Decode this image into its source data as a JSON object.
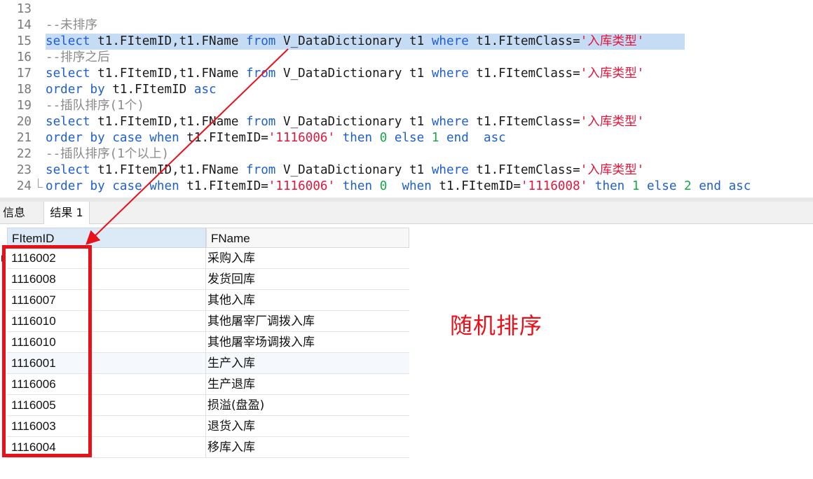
{
  "editor": {
    "lines": [
      {
        "n": "13",
        "tokens": []
      },
      {
        "n": "14",
        "tokens": [
          {
            "t": "--未排序",
            "c": "cm"
          }
        ]
      },
      {
        "n": "15",
        "highlight": true,
        "tokens": [
          {
            "t": "select",
            "c": "kw"
          },
          {
            "t": " t1.FItemID,t1.FName ",
            "c": "id"
          },
          {
            "t": "from",
            "c": "kw"
          },
          {
            "t": " V_DataDictionary t1 ",
            "c": "id"
          },
          {
            "t": "where",
            "c": "kw"
          },
          {
            "t": " t1.FItemClass=",
            "c": "id"
          },
          {
            "t": "'入库类型'",
            "c": "str"
          }
        ]
      },
      {
        "n": "16",
        "tokens": [
          {
            "t": "--排序之后",
            "c": "cm"
          }
        ]
      },
      {
        "n": "17",
        "tokens": [
          {
            "t": "select",
            "c": "kw"
          },
          {
            "t": " t1.FItemID,t1.FName ",
            "c": "id"
          },
          {
            "t": "from",
            "c": "kw"
          },
          {
            "t": " V_DataDictionary t1 ",
            "c": "id"
          },
          {
            "t": "where",
            "c": "kw"
          },
          {
            "t": " t1.FItemClass=",
            "c": "id"
          },
          {
            "t": "'入库类型'",
            "c": "str"
          }
        ]
      },
      {
        "n": "18",
        "tokens": [
          {
            "t": "order by",
            "c": "kw"
          },
          {
            "t": " t1.FItemID ",
            "c": "id"
          },
          {
            "t": "asc",
            "c": "kw"
          }
        ]
      },
      {
        "n": "19",
        "tokens": [
          {
            "t": "--插队排序(1个)",
            "c": "cm"
          }
        ]
      },
      {
        "n": "20",
        "tokens": [
          {
            "t": "select",
            "c": "kw"
          },
          {
            "t": " t1.FItemID,t1.FName ",
            "c": "id"
          },
          {
            "t": "from",
            "c": "kw"
          },
          {
            "t": " V_DataDictionary t1 ",
            "c": "id"
          },
          {
            "t": "where",
            "c": "kw"
          },
          {
            "t": " t1.FItemClass=",
            "c": "id"
          },
          {
            "t": "'入库类型'",
            "c": "str"
          }
        ]
      },
      {
        "n": "21",
        "tokens": [
          {
            "t": "order by case when",
            "c": "kw"
          },
          {
            "t": " t1.FItemID=",
            "c": "id"
          },
          {
            "t": "'1116006'",
            "c": "str"
          },
          {
            "t": " then ",
            "c": "kw"
          },
          {
            "t": "0",
            "c": "num"
          },
          {
            "t": " else ",
            "c": "kw"
          },
          {
            "t": "1",
            "c": "num"
          },
          {
            "t": " end  asc",
            "c": "kw"
          }
        ]
      },
      {
        "n": "22",
        "tokens": [
          {
            "t": "--插队排序(1个以上)",
            "c": "cm"
          }
        ]
      },
      {
        "n": "23",
        "tokens": [
          {
            "t": "select",
            "c": "kw"
          },
          {
            "t": " t1.FItemID,t1.FName ",
            "c": "id"
          },
          {
            "t": "from",
            "c": "kw"
          },
          {
            "t": " V_DataDictionary t1 ",
            "c": "id"
          },
          {
            "t": "where",
            "c": "kw"
          },
          {
            "t": " t1.FItemClass=",
            "c": "id"
          },
          {
            "t": "'入库类型'",
            "c": "str"
          }
        ]
      },
      {
        "n": "24",
        "fold": true,
        "tokens": [
          {
            "t": "order by case when",
            "c": "kw"
          },
          {
            "t": " t1.FItemID=",
            "c": "id"
          },
          {
            "t": "'1116006'",
            "c": "str"
          },
          {
            "t": " then ",
            "c": "kw"
          },
          {
            "t": "0",
            "c": "num"
          },
          {
            "t": "  when",
            "c": "kw"
          },
          {
            "t": " t1.FItemID=",
            "c": "id"
          },
          {
            "t": "'1116008'",
            "c": "str"
          },
          {
            "t": " then ",
            "c": "kw"
          },
          {
            "t": "1",
            "c": "num"
          },
          {
            "t": " else ",
            "c": "kw"
          },
          {
            "t": "2",
            "c": "num"
          },
          {
            "t": " end asc",
            "c": "kw"
          }
        ]
      }
    ]
  },
  "tabs": {
    "info": "信息",
    "result": "结果 1"
  },
  "grid": {
    "columns": [
      "FItemID",
      "FName"
    ],
    "rows": [
      [
        "1116002",
        "采购入库"
      ],
      [
        "1116008",
        "发货回库"
      ],
      [
        "1116007",
        "其他入库"
      ],
      [
        "1116010",
        "其他屠宰厂调拨入库"
      ],
      [
        "1116010",
        "其他屠宰场调拨入库"
      ],
      [
        "1116001",
        "生产入库"
      ],
      [
        "1116006",
        "生产退库"
      ],
      [
        "1116005",
        "损溢(盘盈)"
      ],
      [
        "1116003",
        "退货入库"
      ],
      [
        "1116004",
        "移库入库"
      ]
    ]
  },
  "annotation": {
    "note": "随机排序",
    "color": "#e8111a"
  },
  "colors": {
    "keyword": "#1f5fcf",
    "string": "#e0163d",
    "number": "#18a84a",
    "comment": "#8a8a8a",
    "selection": "#c6dcf5"
  }
}
